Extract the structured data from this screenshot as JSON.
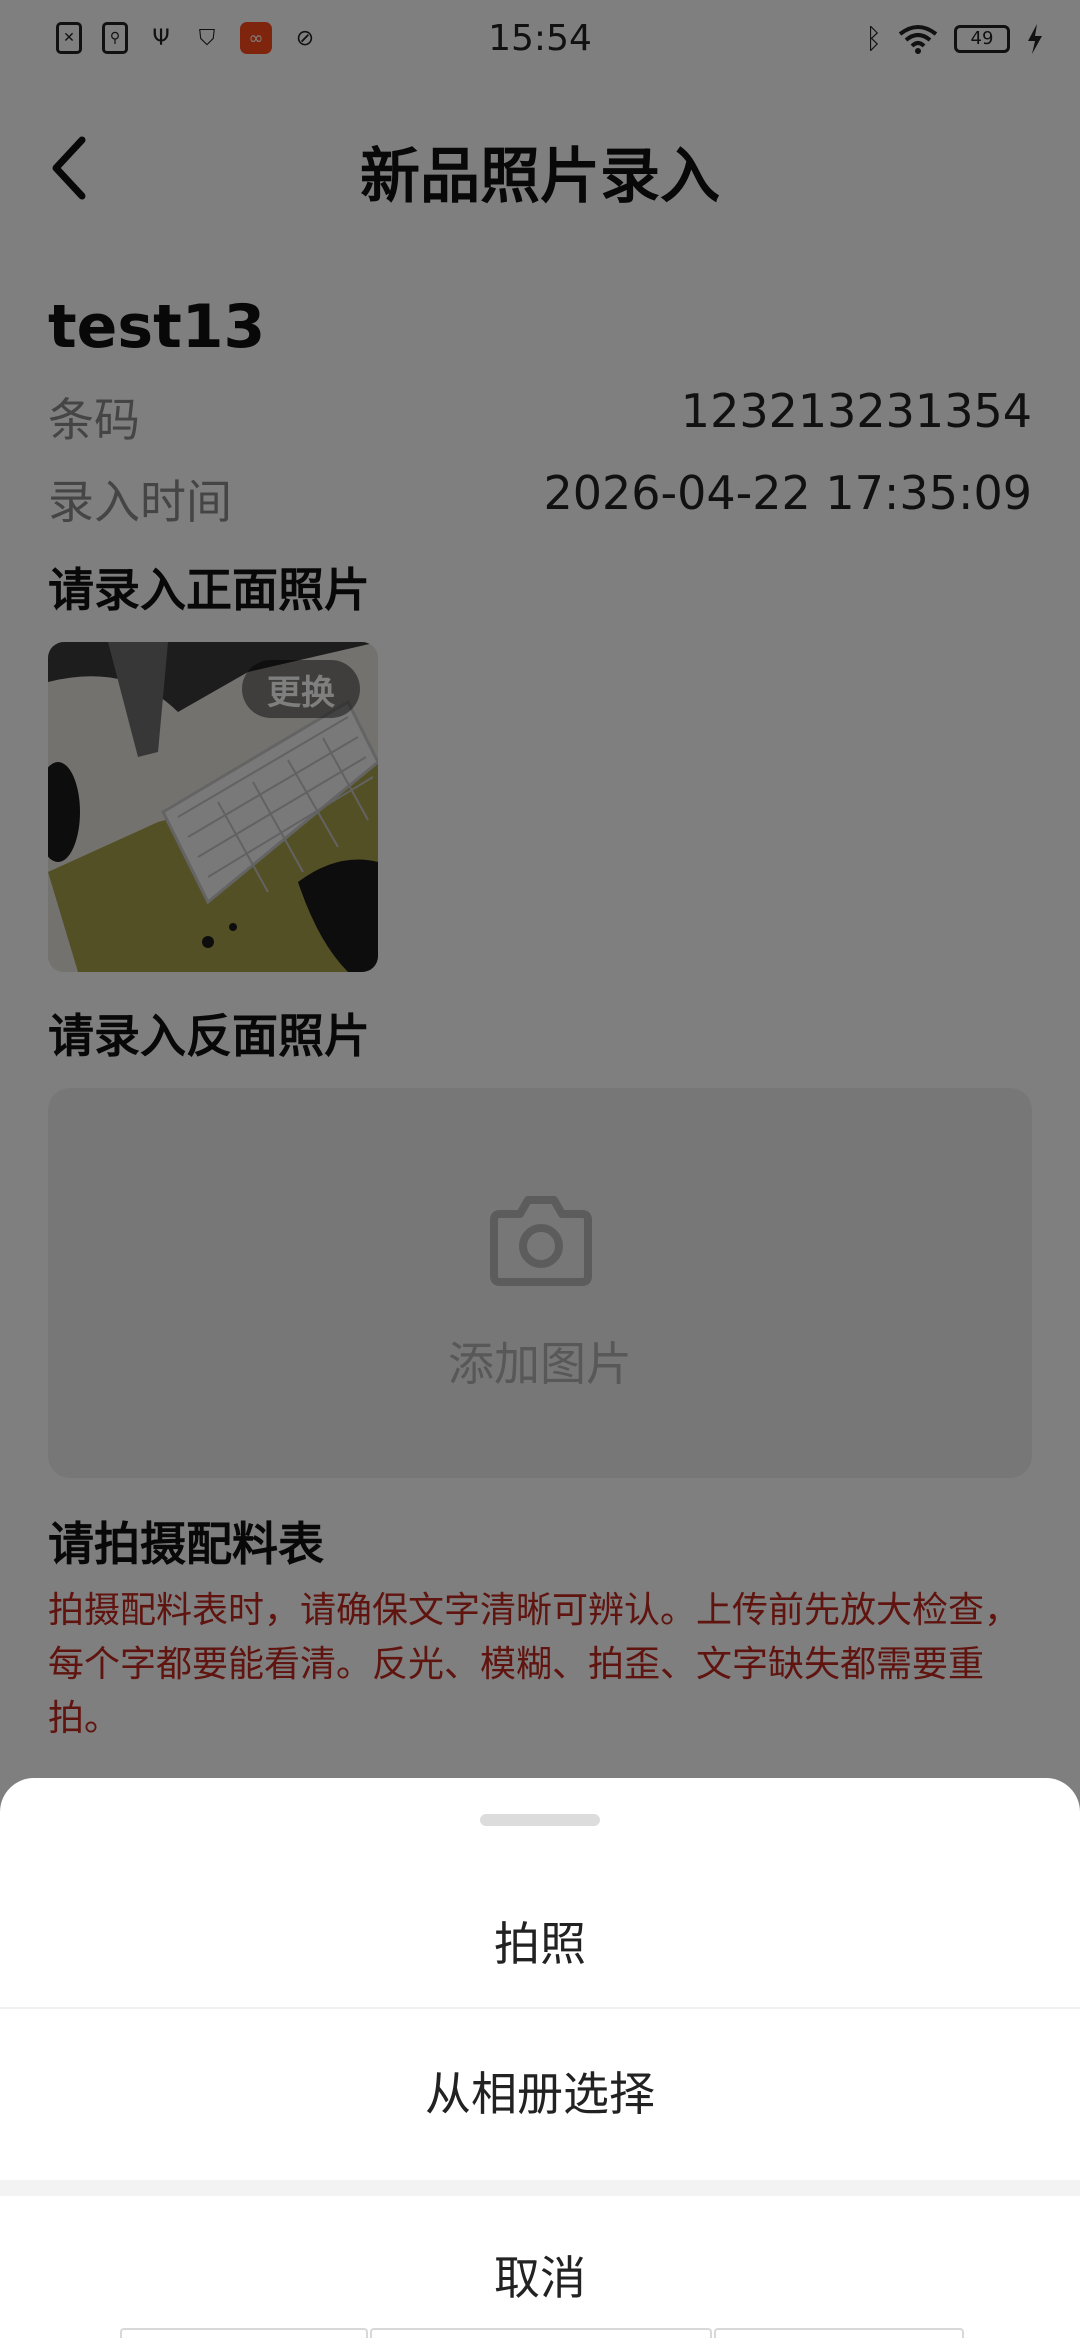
{
  "status_bar": {
    "time": "15:54",
    "battery": "49",
    "left_icons": [
      "sim-card-icon",
      "usb-debug-icon",
      "usb-icon",
      "shield-icon",
      "app-notification-icon",
      "leaf-icon"
    ],
    "right_icons": [
      "bluetooth-icon",
      "wifi-icon",
      "battery-icon",
      "charging-icon"
    ]
  },
  "header": {
    "title": "新品照片录入",
    "back_icon": "chevron-left-icon"
  },
  "product": {
    "name": "test13",
    "barcode_label": "条码",
    "barcode_value": "123213231354",
    "time_label": "录入时间",
    "time_value": "2026-04-22 17:35:09"
  },
  "front_photo": {
    "section_title": "请录入正面照片",
    "replace_label": "更换"
  },
  "back_photo": {
    "section_title": "请录入反面照片",
    "upload_label": "添加图片",
    "icon": "camera-icon"
  },
  "ingredient": {
    "section_title": "请拍摄配料表",
    "tip": "拍摄配料表时，请确保文字清晰可辨认。上传前先放大检查，每个字都要能看清。反光、模糊、拍歪、文字缺失都需要重拍。",
    "tip_color": "#c1281e"
  },
  "action_sheet": {
    "take_photo": "拍照",
    "choose_album": "从相册选择",
    "cancel": "取消"
  }
}
